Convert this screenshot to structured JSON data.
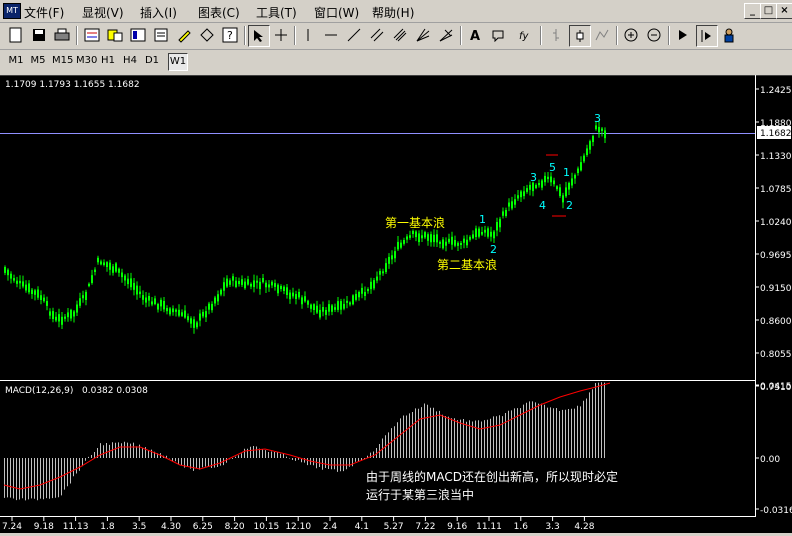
{
  "menu": {
    "items": [
      "文件(F)",
      "显视(V)",
      "插入(I)",
      "图表(C)",
      "工具(T)",
      "窗口(W)",
      "帮助(H)"
    ]
  },
  "window_controls": [
    "_",
    "□",
    "×"
  ],
  "timeframes": {
    "items": [
      "M1",
      "M5",
      "M15",
      "M30",
      "H1",
      "H4",
      "D1",
      "W1"
    ],
    "active": "W1"
  },
  "chart": {
    "ohlc_label": "1.1709 1.1793 1.1655 1.1682",
    "current_price": "1.1682",
    "price_ticks": [
      "1.2425",
      "1.1880",
      "1.1330",
      "1.0785",
      "1.0240",
      "0.9695",
      "0.9150",
      "0.8600",
      "0.8055",
      "0.7510"
    ],
    "macd_label": "MACD(12,26,9)",
    "macd_values": "0.0382 0.0308",
    "macd_ticks": [
      "0.0415",
      "0.00",
      "-0.0316"
    ],
    "date_ticks": [
      "7.24",
      "9.18",
      "11.13",
      "1.8",
      "3.5",
      "4.30",
      "6.25",
      "8.20",
      "10.15",
      "12.10",
      "2.4",
      "4.1",
      "5.27",
      "7.22",
      "9.16",
      "11.11",
      "1.6",
      "3.3",
      "4.28"
    ],
    "annotations": {
      "wave1": "第一基本浪",
      "wave2": "第二基本浪",
      "macd_note_line1": "由于周线的MACD还在创出新高，所以现时必定",
      "macd_note_line2": "运行于某第三浪当中"
    },
    "wave_labels": [
      "1",
      "2",
      "3",
      "4",
      "5",
      "1",
      "2",
      "3"
    ],
    "colors": {
      "candle": "#00ff00",
      "macd_hist": "#c0c0c0",
      "signal": "#ff0000",
      "annotation": "#ffff00",
      "wave_label": "#00ffff",
      "current_line": "#9090ff"
    }
  }
}
